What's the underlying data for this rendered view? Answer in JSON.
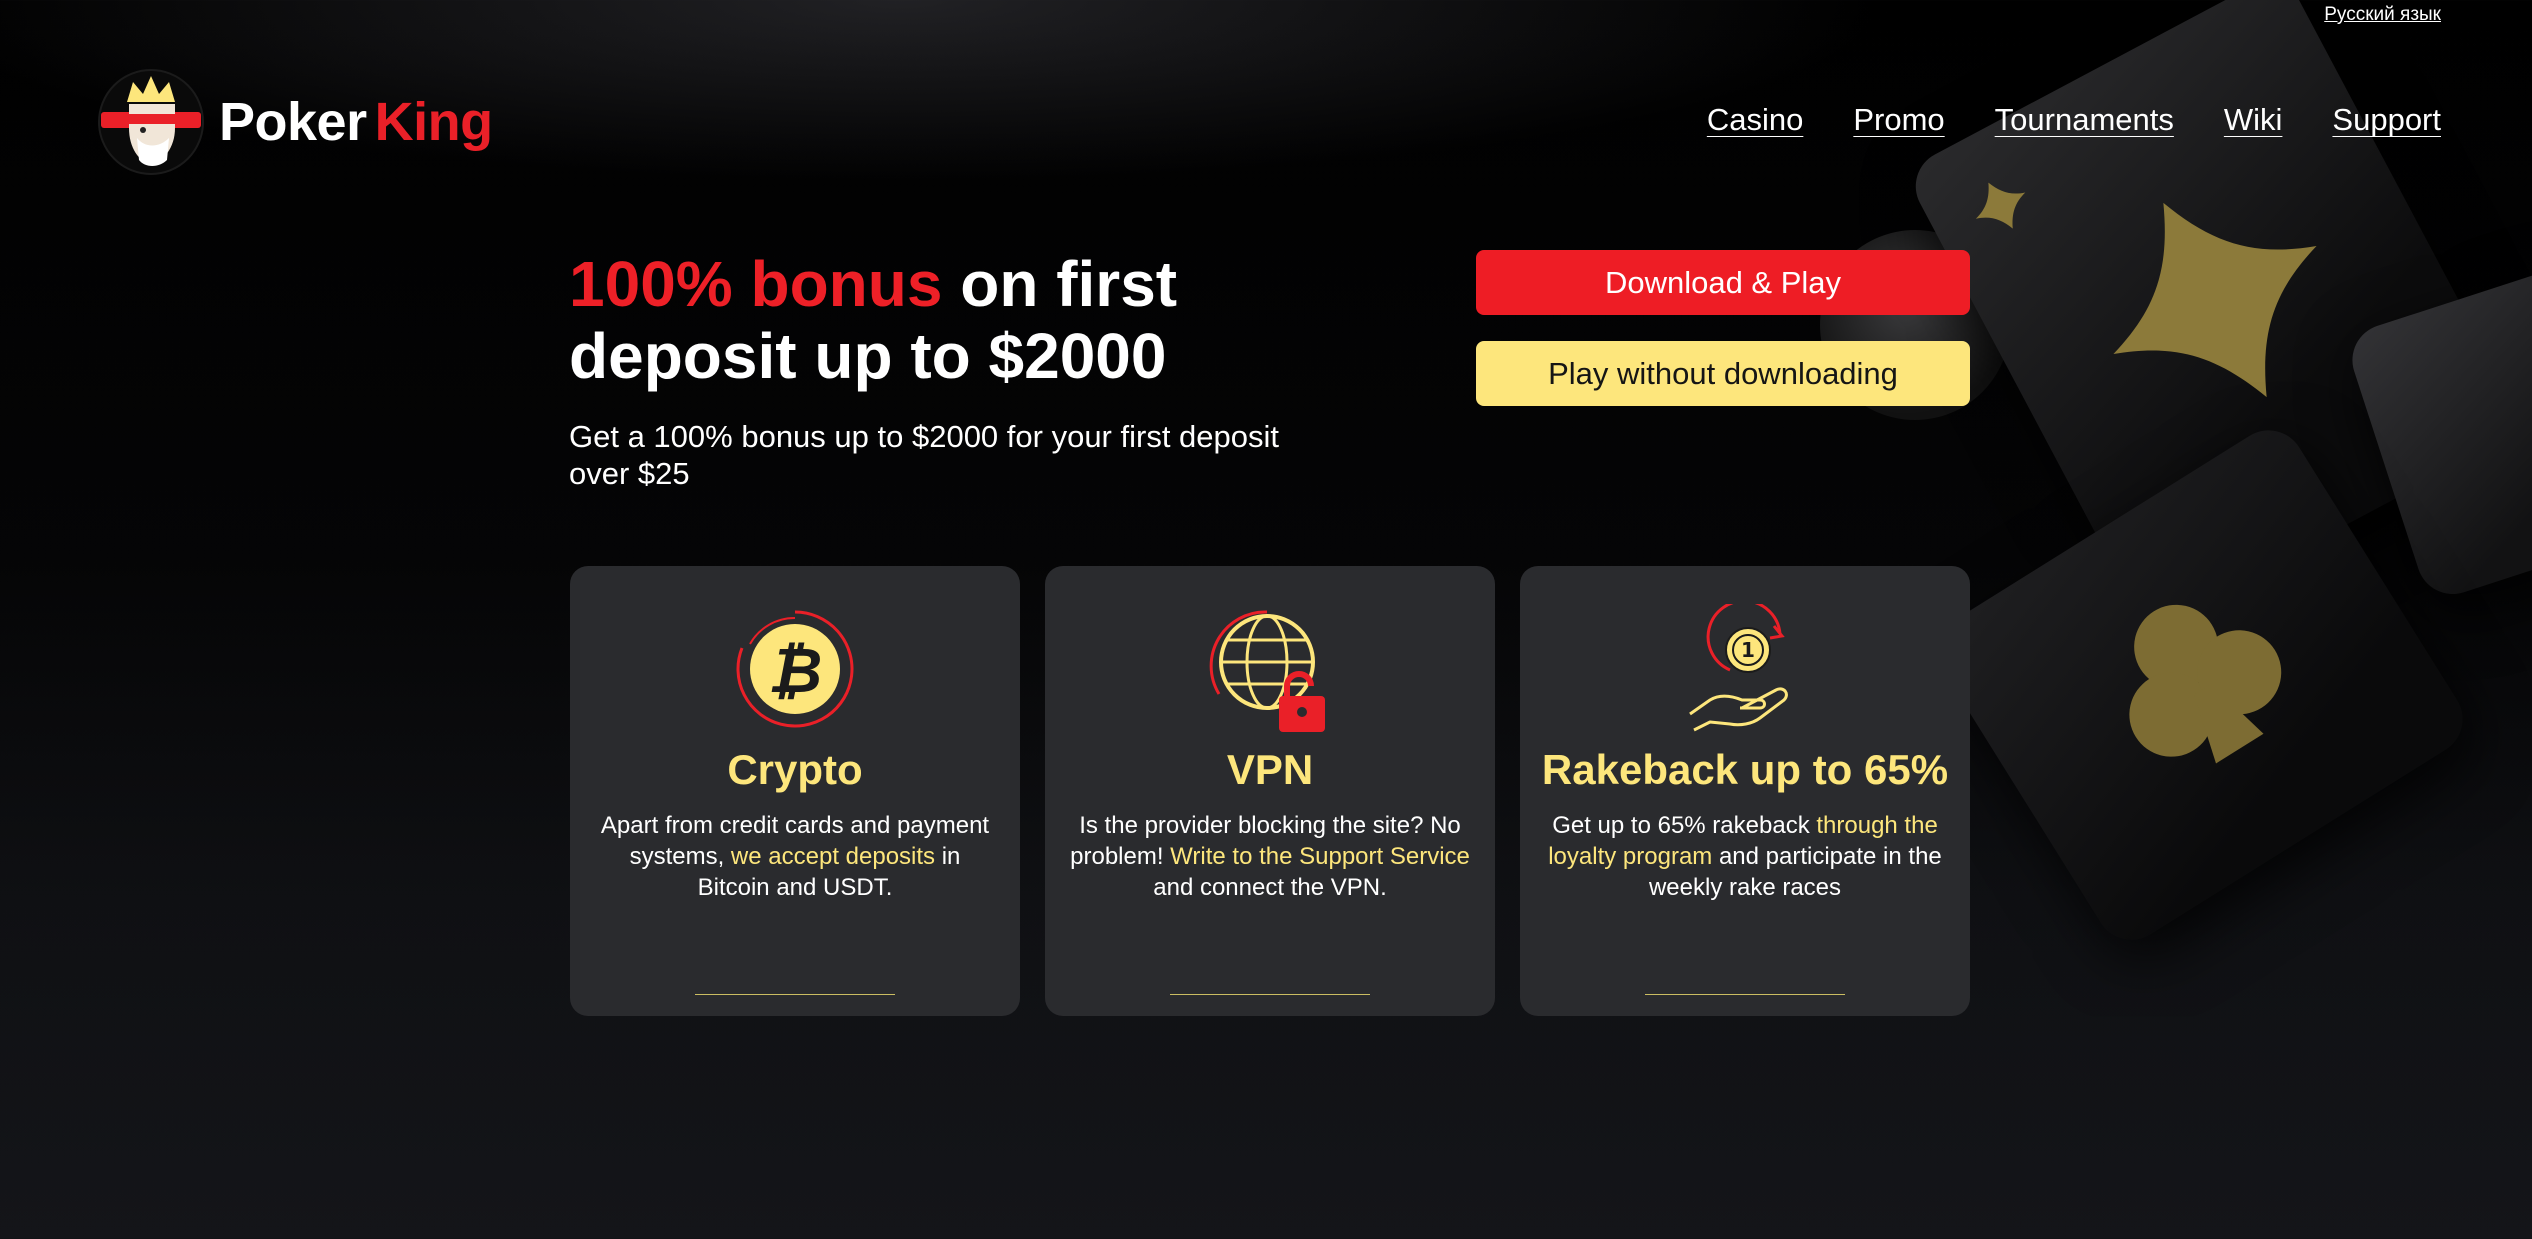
{
  "language_link": "Русский язык",
  "brand": {
    "word1": "Poker",
    "word2": "King"
  },
  "nav": [
    "Casino",
    "Promo",
    "Tournaments",
    "Wiki",
    "Support"
  ],
  "hero": {
    "title_highlight": "100% bonus",
    "title_rest": " on first deposit up to $2000",
    "subtitle": "Get a 100% bonus up to $2000 for your first deposit over $25"
  },
  "buttons": {
    "download": "Download & Play",
    "play_web": "Play without downloading"
  },
  "features": [
    {
      "title": "Crypto",
      "text_before": "Apart from credit cards and payment systems, ",
      "link": "we accept deposits",
      "text_after": " in Bitcoin and USDT.",
      "icon": "bitcoin-icon"
    },
    {
      "title": "VPN",
      "text_before": "Is the provider blocking the site? No problem! ",
      "link": "Write to the Support Service",
      "text_after": " and connect the VPN.",
      "icon": "globe-unlock-icon"
    },
    {
      "title": "Rakeback up to 65%",
      "text_before": "Get up to 65% rakeback ",
      "link": "through the loyalty program",
      "text_after": " and participate in the weekly rake races",
      "icon": "coin-hand-icon"
    }
  ],
  "colors": {
    "accent_red": "#ee1d25",
    "accent_yellow": "#fde67c",
    "card_bg": "#2a2b2e"
  }
}
